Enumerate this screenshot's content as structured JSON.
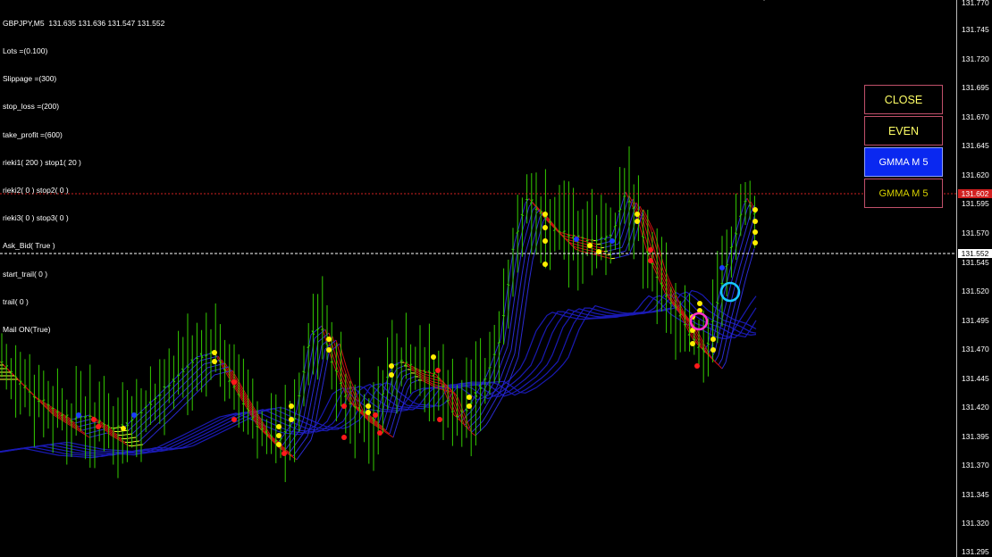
{
  "header": {
    "symbol_line": "GBPJPY,M5  131.635 131.636 131.547 131.552"
  },
  "ea_params": [
    "Lots =(0.100)",
    "Slippage =(300)",
    "stop_loss =(200)",
    "take_profit =(600)",
    "rieki1( 200 ) stop1( 20 )",
    "rieki2( 0 ) stop2( 0 )",
    "rieki3( 0 ) stop3( 0 )",
    "Ask_Bid( True )",
    "start_trail( 0 )",
    "trail( 0 )",
    "Mail ON(True)"
  ],
  "buttons": {
    "close": "CLOSE",
    "even": "EVEN",
    "gmma_active": "GMMA M 5",
    "gmma_inactive": "GMMA M 5"
  },
  "price_axis": {
    "labels": [
      "131.770",
      "131.745",
      "131.720",
      "131.695",
      "131.670",
      "131.645",
      "131.620",
      "131.595",
      "131.570",
      "131.545",
      "131.520",
      "131.495",
      "131.470",
      "131.445",
      "131.420",
      "131.395",
      "131.370",
      "131.345",
      "131.320",
      "131.295"
    ],
    "ask_tag": "131.602",
    "bid_tag": "131.552"
  },
  "colors": {
    "background": "#000000",
    "candle": "#33cc00",
    "ask_line": "#d22020",
    "bid_line": "#ffffff",
    "short_gmma": "#ffff33",
    "long_gmma": "#1a1ab4",
    "bear_dots": "#ff1a1a",
    "bull_dots": "#ffee00",
    "marker_cyan": "#18c8ff",
    "marker_magenta": "#ff33cc"
  }
}
